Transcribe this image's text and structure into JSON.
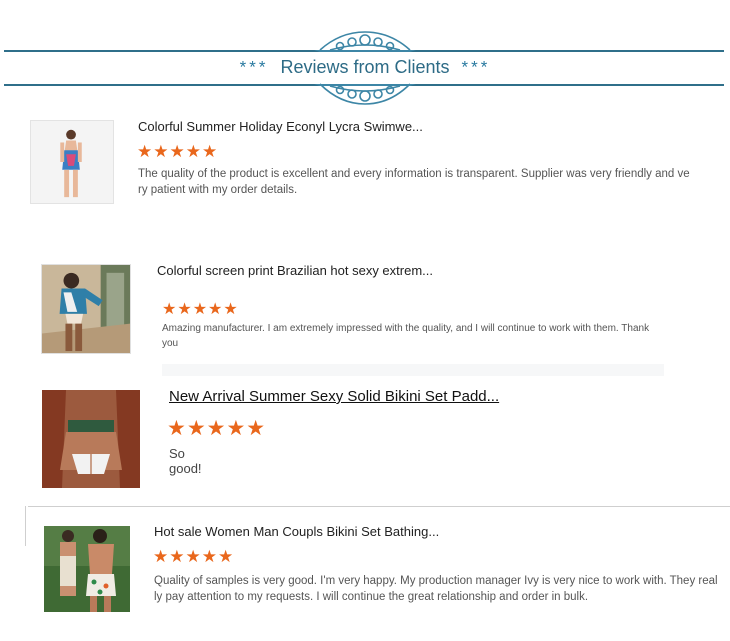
{
  "header": {
    "title": "Reviews from Clients",
    "decoration_left": "***",
    "decoration_right": "***",
    "accent_color": "#2d6b86"
  },
  "reviews": [
    {
      "product_title": "Colorful Summer Holiday Econyl Lycra Swimwe...",
      "rating": 5,
      "stars": "★★★★★",
      "text": "The quality of the product is excellent and every information is transparent. Supplier was very friendly and very patient with my order details.",
      "image_icon": "product-photo-swimsuit"
    },
    {
      "product_title": "Colorful screen print Brazilian hot sexy extrem...",
      "rating": 5,
      "stars": "★★★★★",
      "text": "Amazing manufacturer. I am extremely impressed with the quality, and I will continue to work with them. Thank you",
      "image_icon": "product-photo-bikini"
    },
    {
      "product_title": "New Arrival Summer Sexy Solid Bikini Set Padd...",
      "rating": 5,
      "stars": "★★★★★",
      "text": "So good!",
      "image_icon": "product-photo-bikini-set"
    },
    {
      "product_title": "Hot sale Women Man Coupls Bikini Set Bathing...",
      "rating": 5,
      "stars": "★★★★★",
      "text": "Quality of samples is very good. I'm very happy. My production manager Ivy is very nice to work with. They really pay attention to my requests. I will continue the great relationship and order in bulk.",
      "image_icon": "product-photo-couple-swimwear"
    }
  ],
  "colors": {
    "star": "#e9671c",
    "divider": "#cfcfcf"
  }
}
